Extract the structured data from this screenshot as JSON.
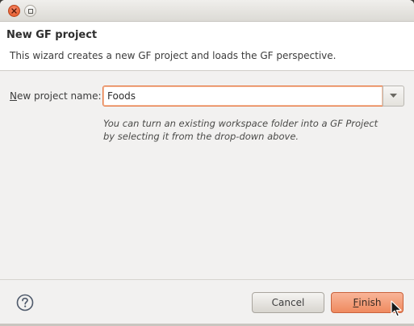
{
  "window": {
    "title": "",
    "close_icon": "close-icon",
    "maximize_icon": "maximize-icon"
  },
  "header": {
    "title": "New GF project",
    "description": "This wizard creates a new GF project and loads the GF perspective."
  },
  "form": {
    "project_name_label_mnemonic": "N",
    "project_name_label_rest": "ew project name:",
    "project_name_value": "Foods",
    "dropdown_icon": "chevron-down-icon",
    "hint_line1": "You can turn an existing workspace folder into a GF Project",
    "hint_line2": "by selecting it from the drop-down above."
  },
  "footer": {
    "help_icon": "help-icon",
    "cancel_label": "Cancel",
    "finish_mnemonic": "F",
    "finish_rest": "inish"
  },
  "colors": {
    "accent": "#e5743d",
    "finish_bg": "#f09c78",
    "close_button": "#e2531f"
  }
}
